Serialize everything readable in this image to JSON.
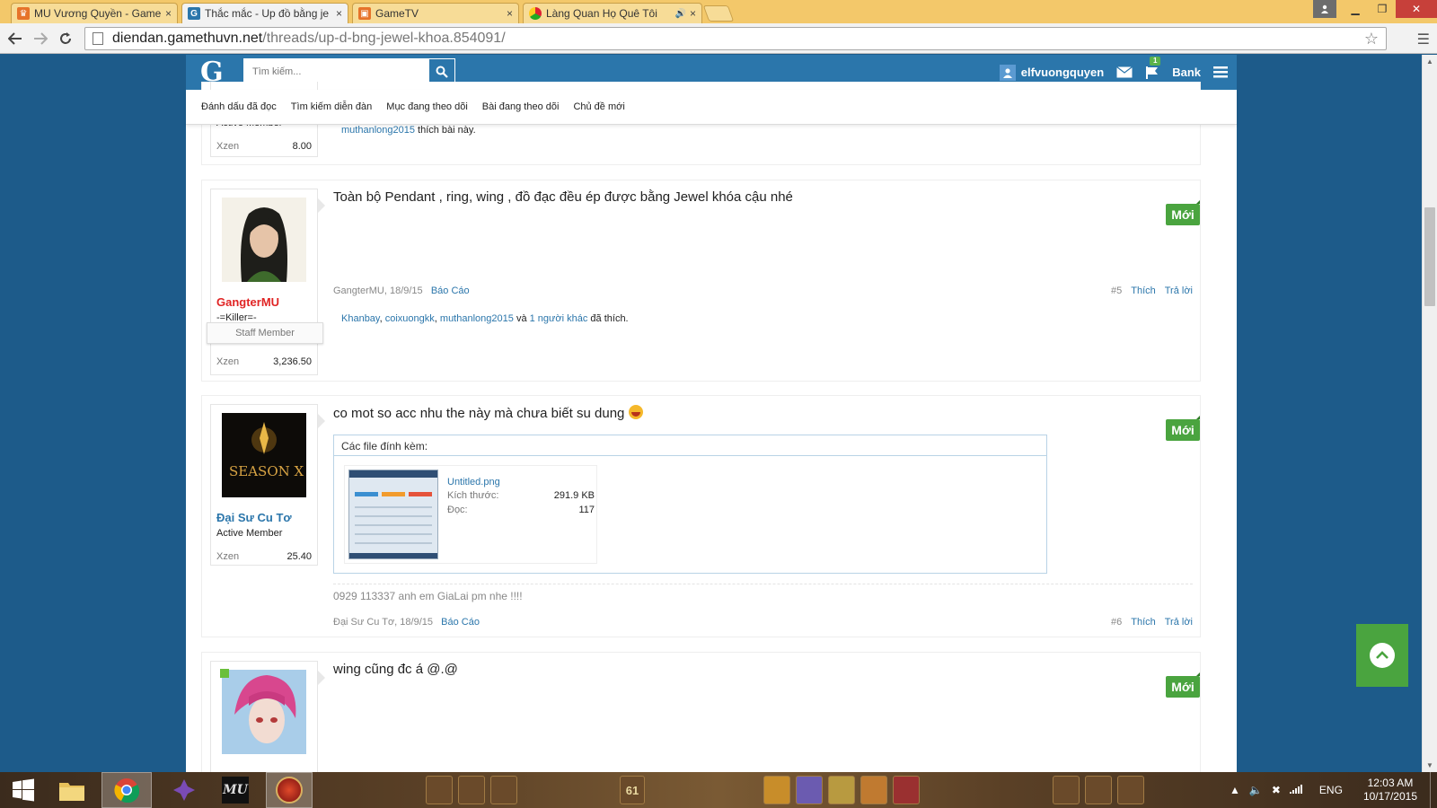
{
  "browser": {
    "tabs": [
      {
        "title": "MU Vương Quyền - Game",
        "favicon_color": "#e6732a",
        "favicon": "mu-icon"
      },
      {
        "title": "Thắc mắc - Up đồ bằng je",
        "favicon_color": "#2b76ab",
        "favicon": "g-icon",
        "active": true
      },
      {
        "title": "GameTV",
        "favicon_color": "#e6732a",
        "favicon": "gametv-icon"
      },
      {
        "title": "Làng Quan Họ Quê Tôi",
        "favicon_color": "#4b8f3a",
        "favicon": "chrome-icon"
      }
    ],
    "close_glyph": "×",
    "url_host": "diendan.gamethuvn.net",
    "url_path": "/threads/up-d-bng-jewel-khoa.854091/"
  },
  "site": {
    "logo": "G",
    "search_placeholder": "Tìm kiếm...",
    "username": "elfvuongquyen",
    "flag_count": "1",
    "bank": "Bank",
    "subnav": [
      "Đánh dấu đã đọc",
      "Tìm kiếm diễn đàn",
      "Mục đang theo dõi",
      "Bài đang theo dõi",
      "Chủ đề mới"
    ]
  },
  "post_prev": {
    "user_title": "Active Member",
    "xzen_label": "Xzen",
    "xzen": "8.00",
    "liker": "muthanlong2015",
    "like_suffix": "thích bài này."
  },
  "post5": {
    "username": "GangterMU",
    "username_color": "#e02424",
    "user_title": "-=Killer=-",
    "staff": "Staff Member",
    "xzen_label": "Xzen",
    "xzen": "3,236.50",
    "message": "Toàn bộ Pendant , ring, wing , đồ đạc đều ép được bằng Jewel khóa cậu nhé",
    "new_badge": "Mới",
    "meta_author": "GangterMU, 18/9/15",
    "report": "Báo Cáo",
    "number": "#5",
    "like": "Thích",
    "reply": "Trả lời",
    "likers": [
      "Khanbay",
      "coixuongkk",
      "muthanlong2015"
    ],
    "and": "và",
    "others": "1 người khác",
    "liked": "đã thích."
  },
  "post6": {
    "username": "Đại Sư Cu Tơ",
    "username_color": "#2b76ab",
    "user_title": "Active Member",
    "avatar_text": "SEASON X",
    "xzen_label": "Xzen",
    "xzen": "25.40",
    "message": "co mot so acc nhu the này mà chưa biết su dung",
    "emoji": "laughing-emoji",
    "new_badge": "Mới",
    "attach_heading": "Các file đính kèm:",
    "file_name": "Untitled.png",
    "size_label": "Kích thước:",
    "size": "291.9 KB",
    "views_label": "Đọc:",
    "views": "117",
    "signature": "0929 113337 anh em GiaLai pm nhe !!!!",
    "meta_author": "Đại Sư Cu Tơ, 18/9/15",
    "report": "Báo Cáo",
    "number": "#6",
    "like": "Thích",
    "reply": "Trả lời"
  },
  "post7": {
    "message": "wing cũng đc á @.@",
    "new_badge": "Mới"
  },
  "taskbar": {
    "lang": "ENG",
    "time": "12:03 AM",
    "date": "10/17/2015",
    "game_level": "61"
  },
  "colors": {
    "accent": "#2b76ab",
    "new_badge": "#4aa43f",
    "page_bg": "#1d5b8a"
  }
}
